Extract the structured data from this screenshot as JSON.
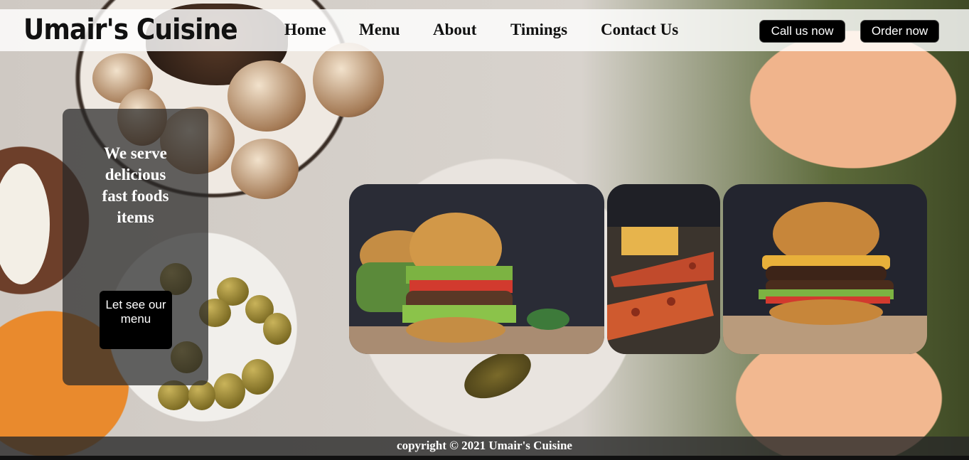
{
  "header": {
    "logo_text": "Umair's Cuisine",
    "nav": [
      {
        "label": "Home"
      },
      {
        "label": "Menu"
      },
      {
        "label": "About"
      },
      {
        "label": "Timings"
      },
      {
        "label": "Contact Us"
      }
    ],
    "call_button": "Call us now",
    "order_button": "Order now"
  },
  "hero": {
    "tagline": "We serve delicious fast foods items",
    "menu_button": "Let see our menu"
  },
  "gallery": [
    {
      "name": "burger-image-1"
    },
    {
      "name": "pizza-fries-image"
    },
    {
      "name": "burger-image-2"
    }
  ],
  "footer": {
    "copyright": "copyright © 2021 Umair's Cuisine"
  },
  "colors": {
    "nav_bg": "#ffffff",
    "button_bg": "#000000",
    "button_text": "#ffffff",
    "card_bg": "#282828"
  }
}
